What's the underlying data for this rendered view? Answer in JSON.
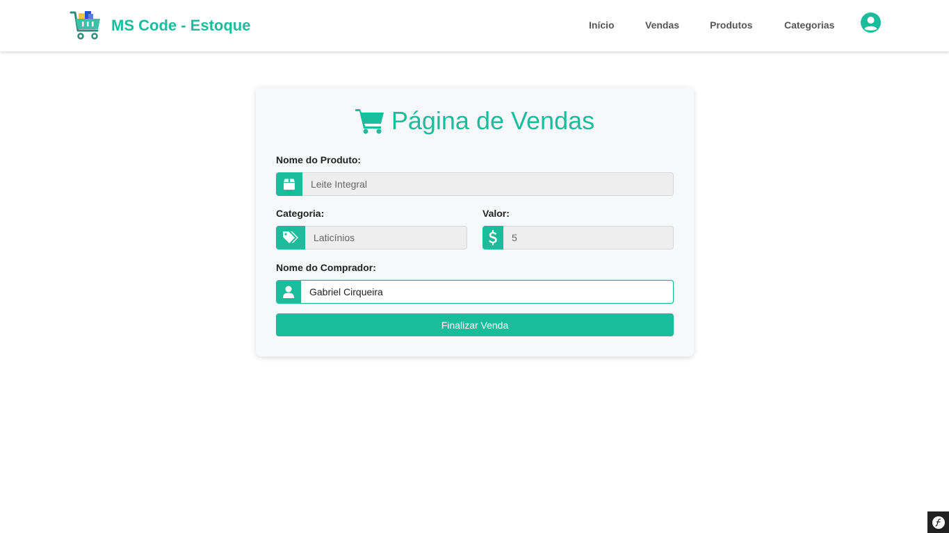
{
  "brand": {
    "name": "MS Code - Estoque",
    "logo_icon": "shopping-cart-logo-icon"
  },
  "nav": {
    "items": [
      {
        "label": "Início"
      },
      {
        "label": "Vendas"
      },
      {
        "label": "Produtos"
      },
      {
        "label": "Categorias"
      }
    ],
    "user_icon": "user-circle-icon"
  },
  "form": {
    "title": "Página de Vendas",
    "title_icon": "shopping-cart-icon",
    "product": {
      "label": "Nome do Produto:",
      "value": "Leite Integral",
      "icon": "box-icon"
    },
    "category": {
      "label": "Categoria:",
      "value": "Laticínios",
      "icon": "tags-icon"
    },
    "price": {
      "label": "Valor:",
      "value": "5",
      "icon": "dollar-icon"
    },
    "buyer": {
      "label": "Nome do Comprador:",
      "value": "Gabriel Cirqueira",
      "icon": "user-icon"
    },
    "submit_label": "Finalizar Venda"
  },
  "colors": {
    "accent": "#1abc9c",
    "text_dark": "#222222",
    "nav_text": "#555555",
    "card_bg": "#f7f8f9"
  },
  "toolbar_badge": "symfony-logo-icon"
}
